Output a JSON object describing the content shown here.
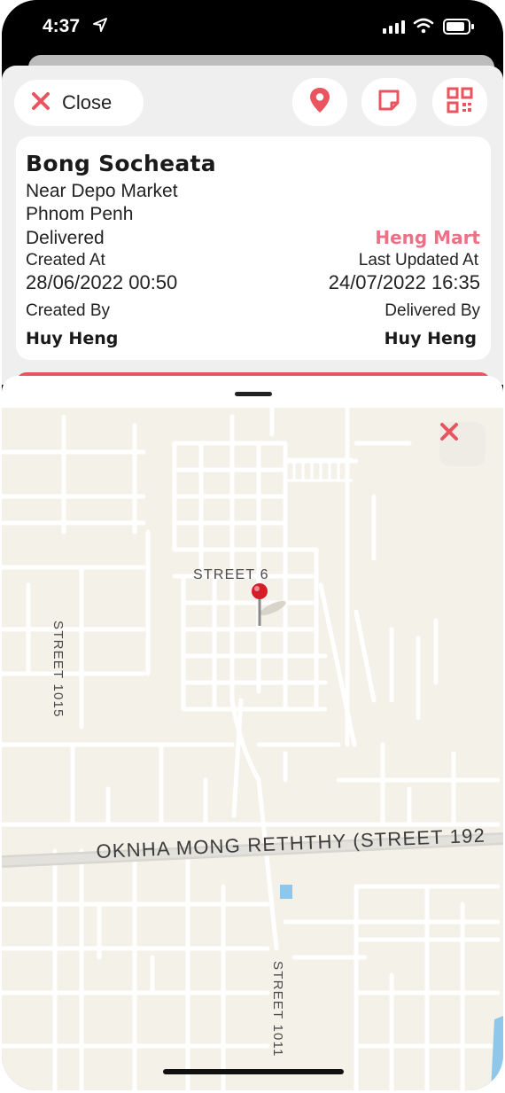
{
  "status_bar": {
    "time": "4:37"
  },
  "header": {
    "close_label": "Close"
  },
  "order": {
    "customer_name": "Bong Socheata",
    "address_line1": "Near Depo Market",
    "address_line2": "Phnom Penh",
    "status": "Delivered",
    "store": "Heng Mart",
    "created_at_label": "Created At",
    "created_at": "28/06/2022 00:50",
    "updated_at_label": "Last Updated At",
    "updated_at": "24/07/2022 16:35",
    "created_by_label": "Created By",
    "created_by": "Huy Heng",
    "delivered_by_label": "Delivered By",
    "delivered_by": "Huy Heng"
  },
  "map": {
    "streets": {
      "street6": "STREET 6",
      "street1015": "STREET 1015",
      "street1011": "STREET 1011",
      "main_road": "OKNHA MONG RETHTHY (STREET 192"
    }
  },
  "colors": {
    "accent": "#e9545f",
    "store_text": "#ef6f86",
    "map_bg": "#f4f1e9"
  }
}
